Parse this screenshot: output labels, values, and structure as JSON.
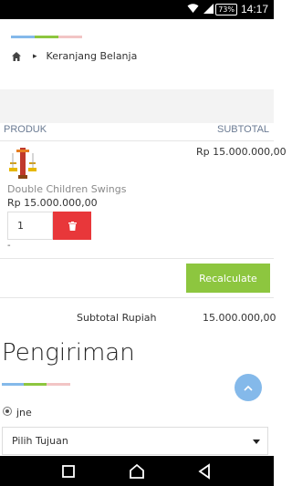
{
  "status_bar": {
    "battery": "73%",
    "time": "14:17"
  },
  "header": {
    "stripe_colors": [
      "#84b9ea",
      "#8dc63f",
      "#f2c5c5"
    ],
    "breadcrumb": {
      "home_icon": "home-icon",
      "current": "Keranjang Belanja"
    }
  },
  "cart_table": {
    "columns": [
      "PRODUK",
      "SUBTOTAL"
    ],
    "items": [
      {
        "name": "Double Children Swings",
        "price": "Rp 15.000.000,00",
        "subtotal": "Rp 15.000.000,00",
        "quantity": "1",
        "note": "-"
      }
    ]
  },
  "actions": {
    "recalculate_label": "Recalculate",
    "delete_icon": "trash-icon"
  },
  "summary": {
    "label": "Subtotal Rupiah",
    "value": "15.000.000,00"
  },
  "shipping": {
    "title": "Pengiriman",
    "courier_option": "jne",
    "destination_placeholder": "Pilih Tujuan"
  },
  "colors": {
    "accent_green": "#8dc63f",
    "delete_red": "#e8373a",
    "fab_blue": "#84b9ea"
  }
}
